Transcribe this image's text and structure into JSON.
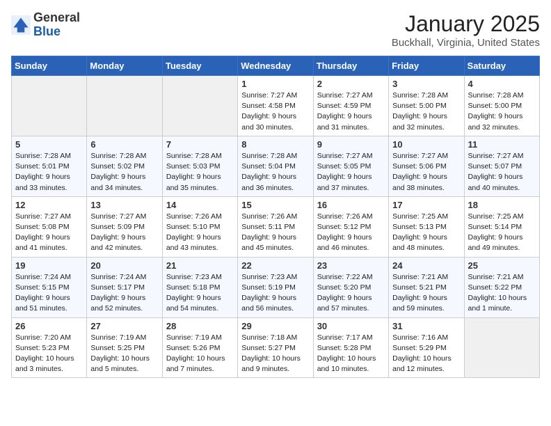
{
  "header": {
    "logo_general": "General",
    "logo_blue": "Blue",
    "title": "January 2025",
    "subtitle": "Buckhall, Virginia, United States"
  },
  "weekdays": [
    "Sunday",
    "Monday",
    "Tuesday",
    "Wednesday",
    "Thursday",
    "Friday",
    "Saturday"
  ],
  "weeks": [
    [
      {
        "day": "",
        "info": ""
      },
      {
        "day": "",
        "info": ""
      },
      {
        "day": "",
        "info": ""
      },
      {
        "day": "1",
        "info": "Sunrise: 7:27 AM\nSunset: 4:58 PM\nDaylight: 9 hours\nand 30 minutes."
      },
      {
        "day": "2",
        "info": "Sunrise: 7:27 AM\nSunset: 4:59 PM\nDaylight: 9 hours\nand 31 minutes."
      },
      {
        "day": "3",
        "info": "Sunrise: 7:28 AM\nSunset: 5:00 PM\nDaylight: 9 hours\nand 32 minutes."
      },
      {
        "day": "4",
        "info": "Sunrise: 7:28 AM\nSunset: 5:00 PM\nDaylight: 9 hours\nand 32 minutes."
      }
    ],
    [
      {
        "day": "5",
        "info": "Sunrise: 7:28 AM\nSunset: 5:01 PM\nDaylight: 9 hours\nand 33 minutes."
      },
      {
        "day": "6",
        "info": "Sunrise: 7:28 AM\nSunset: 5:02 PM\nDaylight: 9 hours\nand 34 minutes."
      },
      {
        "day": "7",
        "info": "Sunrise: 7:28 AM\nSunset: 5:03 PM\nDaylight: 9 hours\nand 35 minutes."
      },
      {
        "day": "8",
        "info": "Sunrise: 7:28 AM\nSunset: 5:04 PM\nDaylight: 9 hours\nand 36 minutes."
      },
      {
        "day": "9",
        "info": "Sunrise: 7:27 AM\nSunset: 5:05 PM\nDaylight: 9 hours\nand 37 minutes."
      },
      {
        "day": "10",
        "info": "Sunrise: 7:27 AM\nSunset: 5:06 PM\nDaylight: 9 hours\nand 38 minutes."
      },
      {
        "day": "11",
        "info": "Sunrise: 7:27 AM\nSunset: 5:07 PM\nDaylight: 9 hours\nand 40 minutes."
      }
    ],
    [
      {
        "day": "12",
        "info": "Sunrise: 7:27 AM\nSunset: 5:08 PM\nDaylight: 9 hours\nand 41 minutes."
      },
      {
        "day": "13",
        "info": "Sunrise: 7:27 AM\nSunset: 5:09 PM\nDaylight: 9 hours\nand 42 minutes."
      },
      {
        "day": "14",
        "info": "Sunrise: 7:26 AM\nSunset: 5:10 PM\nDaylight: 9 hours\nand 43 minutes."
      },
      {
        "day": "15",
        "info": "Sunrise: 7:26 AM\nSunset: 5:11 PM\nDaylight: 9 hours\nand 45 minutes."
      },
      {
        "day": "16",
        "info": "Sunrise: 7:26 AM\nSunset: 5:12 PM\nDaylight: 9 hours\nand 46 minutes."
      },
      {
        "day": "17",
        "info": "Sunrise: 7:25 AM\nSunset: 5:13 PM\nDaylight: 9 hours\nand 48 minutes."
      },
      {
        "day": "18",
        "info": "Sunrise: 7:25 AM\nSunset: 5:14 PM\nDaylight: 9 hours\nand 49 minutes."
      }
    ],
    [
      {
        "day": "19",
        "info": "Sunrise: 7:24 AM\nSunset: 5:15 PM\nDaylight: 9 hours\nand 51 minutes."
      },
      {
        "day": "20",
        "info": "Sunrise: 7:24 AM\nSunset: 5:17 PM\nDaylight: 9 hours\nand 52 minutes."
      },
      {
        "day": "21",
        "info": "Sunrise: 7:23 AM\nSunset: 5:18 PM\nDaylight: 9 hours\nand 54 minutes."
      },
      {
        "day": "22",
        "info": "Sunrise: 7:23 AM\nSunset: 5:19 PM\nDaylight: 9 hours\nand 56 minutes."
      },
      {
        "day": "23",
        "info": "Sunrise: 7:22 AM\nSunset: 5:20 PM\nDaylight: 9 hours\nand 57 minutes."
      },
      {
        "day": "24",
        "info": "Sunrise: 7:21 AM\nSunset: 5:21 PM\nDaylight: 9 hours\nand 59 minutes."
      },
      {
        "day": "25",
        "info": "Sunrise: 7:21 AM\nSunset: 5:22 PM\nDaylight: 10 hours\nand 1 minute."
      }
    ],
    [
      {
        "day": "26",
        "info": "Sunrise: 7:20 AM\nSunset: 5:23 PM\nDaylight: 10 hours\nand 3 minutes."
      },
      {
        "day": "27",
        "info": "Sunrise: 7:19 AM\nSunset: 5:25 PM\nDaylight: 10 hours\nand 5 minutes."
      },
      {
        "day": "28",
        "info": "Sunrise: 7:19 AM\nSunset: 5:26 PM\nDaylight: 10 hours\nand 7 minutes."
      },
      {
        "day": "29",
        "info": "Sunrise: 7:18 AM\nSunset: 5:27 PM\nDaylight: 10 hours\nand 9 minutes."
      },
      {
        "day": "30",
        "info": "Sunrise: 7:17 AM\nSunset: 5:28 PM\nDaylight: 10 hours\nand 10 minutes."
      },
      {
        "day": "31",
        "info": "Sunrise: 7:16 AM\nSunset: 5:29 PM\nDaylight: 10 hours\nand 12 minutes."
      },
      {
        "day": "",
        "info": ""
      }
    ]
  ]
}
